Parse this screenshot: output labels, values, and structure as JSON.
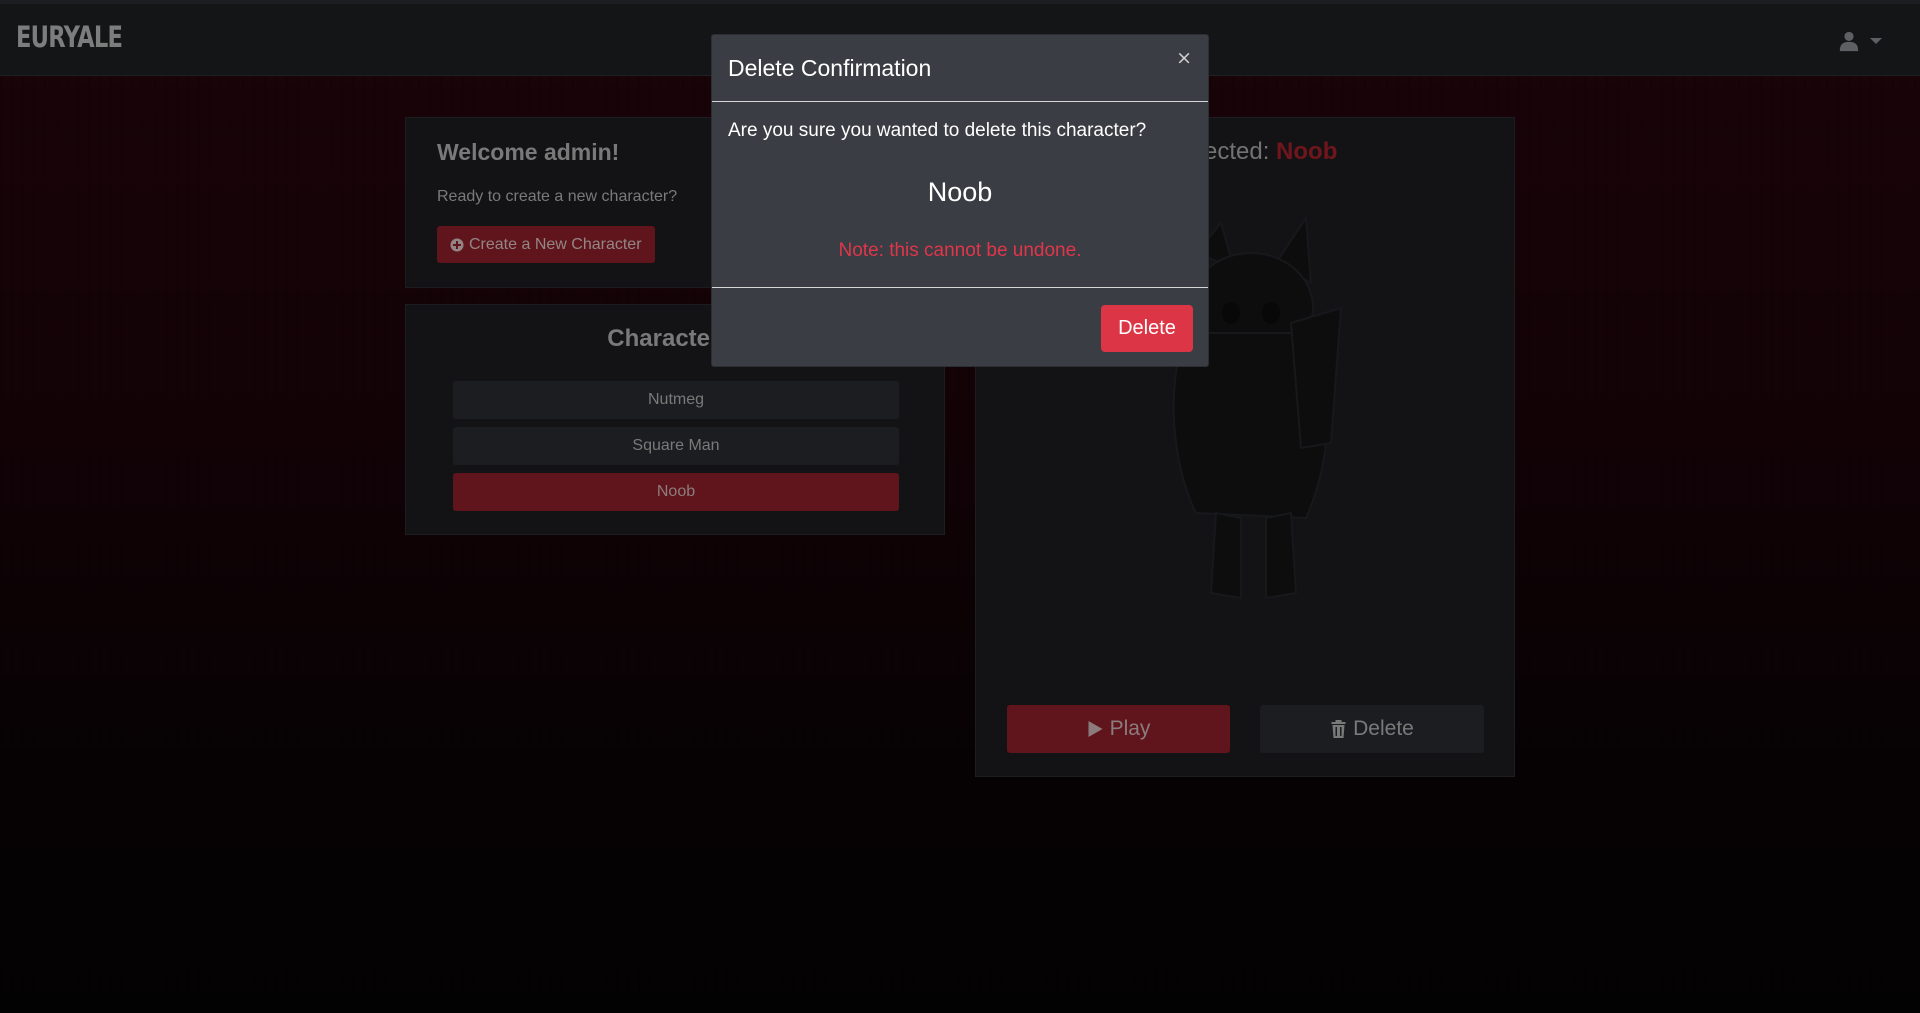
{
  "navbar": {
    "brand": "EURYALE",
    "user_icon": "user-icon",
    "caret_icon": "caret-down-icon"
  },
  "welcome": {
    "title": "Welcome admin!",
    "subtitle": "Ready to create a new character?",
    "create_button": "Create a New Character",
    "create_icon": "plus-circle-icon"
  },
  "character_grid": {
    "title_visible": "Character G",
    "items": [
      {
        "label": "Nutmeg",
        "selected": false
      },
      {
        "label": "Square Man",
        "selected": false
      },
      {
        "label": "Noob",
        "selected": true
      }
    ]
  },
  "selected_panel": {
    "title_prefix": "r Selected: ",
    "name": "Noob",
    "portrait": "character-portrait-image",
    "play_button": "Play",
    "play_icon": "play-icon",
    "delete_button": "Delete",
    "delete_icon": "trash-icon"
  },
  "modal": {
    "title": "Delete Confirmation",
    "close_label": "×",
    "question": "Are you sure you wanted to delete this character?",
    "character_name": "Noob",
    "note": "Note: this cannot be undone.",
    "confirm_button": "Delete"
  },
  "colors": {
    "accent": "#8c1f28",
    "danger": "#dc3545",
    "note_text": "#e0364a",
    "navbar": "#1e1f22",
    "card": "#1c1d20",
    "modal": "#3a3d43"
  }
}
